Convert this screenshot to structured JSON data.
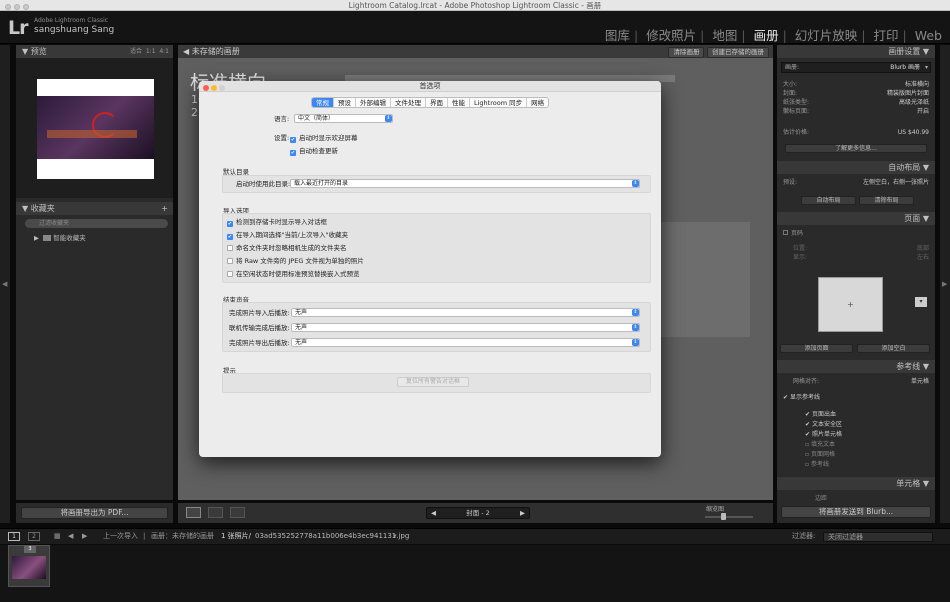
{
  "window": {
    "title": "Lightroom Catalog.lrcat - Adobe Photoshop Lightroom Classic - 画册"
  },
  "header": {
    "logo": "Lr",
    "product": "Adobe Lightroom Classic",
    "user": "sangshuang Sang",
    "modules": [
      "图库",
      "修改照片",
      "地图",
      "画册",
      "幻灯片放映",
      "打印",
      "Web"
    ],
    "active_module": "画册"
  },
  "left": {
    "preview_title": "预览",
    "zoom": [
      "适合",
      "1:1",
      "4:1"
    ],
    "collections_title": "收藏夹",
    "collections_filter": "过滤收藏夹",
    "smart_collections": "智能收藏夹",
    "export_pdf": "将画册导出为 PDF..."
  },
  "center": {
    "unsaved": "未存储的画册",
    "clear_book": "清除画册",
    "create_saved": "创建已存储的画册",
    "book_title": "标准横向",
    "size_line1": "10",
    "size_line2": "2",
    "page_nav": "封面 - 2",
    "thumb_label": "缩览图"
  },
  "dialog": {
    "title": "首选项",
    "tabs": [
      "常规",
      "预设",
      "外部编辑",
      "文件处理",
      "界面",
      "性能",
      "Lightroom 同步",
      "网络"
    ],
    "active_tab": "常规",
    "language_label": "语言:",
    "language_value": "中文（简体）",
    "settings_label": "设置:",
    "show_splash": "启动时显示欢迎屏幕",
    "auto_update": "自动检查更新",
    "default_catalog_title": "默认目录",
    "catalog_label": "启动时使用此目录:",
    "catalog_value": "载入最近打开的目录",
    "import_title": "导入选项",
    "import_opts": [
      {
        "label": "检测到存储卡时显示导入对话框",
        "checked": true
      },
      {
        "label": "在导入期间选择\"当前/上次导入\"收藏夹",
        "checked": true
      },
      {
        "label": "命名文件夹时忽略相机生成的文件夹名",
        "checked": false
      },
      {
        "label": "将 Raw 文件旁的 JPEG 文件视为单独的照片",
        "checked": false
      },
      {
        "label": "在空闲状态时使用标准预览替换嵌入式预览",
        "checked": false
      }
    ],
    "sound_title": "结束声音",
    "sounds": [
      {
        "label": "完成照片导入后播放:",
        "value": "无声"
      },
      {
        "label": "联机传输完成后播放:",
        "value": "无声"
      },
      {
        "label": "完成照片导出后播放:",
        "value": "无声"
      }
    ],
    "prompts_title": "提示",
    "reset_warnings": "复位所有警告对话框"
  },
  "right": {
    "book_settings": "画册设置",
    "book_label": "画册:",
    "book_value": "Blurb 画册",
    "rows": [
      {
        "k": "大小:",
        "v": "标准横向"
      },
      {
        "k": "封面:",
        "v": "精装版图片封面"
      },
      {
        "k": "纸张类型:",
        "v": "高级光泽纸"
      },
      {
        "k": "徽标页面:",
        "v": "开启"
      }
    ],
    "price_label": "估计价格:",
    "price_value": "US $40.99",
    "learn_more": "了解更多信息...",
    "auto_layout": "自动布局",
    "preset_label": "预设:",
    "preset_value": "左侧空白，右侧一张照片",
    "auto_layout_btn": "自动布局",
    "clear_layout_btn": "清除布局",
    "page": "页面",
    "page_numbers": "页码",
    "position_label": "位置:",
    "position_value": "底部",
    "display_label": "显示:",
    "display_value": "左右",
    "add_page": "添加页面",
    "add_blank": "添加空白",
    "guides": "参考线",
    "grid_snap_label": "网格对齐:",
    "grid_snap_value": "单元格",
    "show_guides": "显示参考线",
    "guide_items": [
      {
        "label": "页面出血",
        "checked": true
      },
      {
        "label": "文本安全区",
        "checked": true
      },
      {
        "label": "照片单元格",
        "checked": true
      },
      {
        "label": "填充文本",
        "checked": false
      },
      {
        "label": "页面网格",
        "checked": false
      },
      {
        "label": "参考线",
        "checked": false
      }
    ],
    "cell": "单元格",
    "padding": "边距",
    "send_blurb": "将画册发送到 Blurb..."
  },
  "filmstrip": {
    "prev_import": "上一次导入",
    "path": "画册：未存储的画册",
    "count": "1 张照片/",
    "filename": "03ad535252778a11b006e4b3ec941131.jpg",
    "filter_label": "过滤器:",
    "filter_value": "关闭过滤器",
    "badge": "3"
  },
  "colors": {
    "accent": "#3c86f5"
  }
}
